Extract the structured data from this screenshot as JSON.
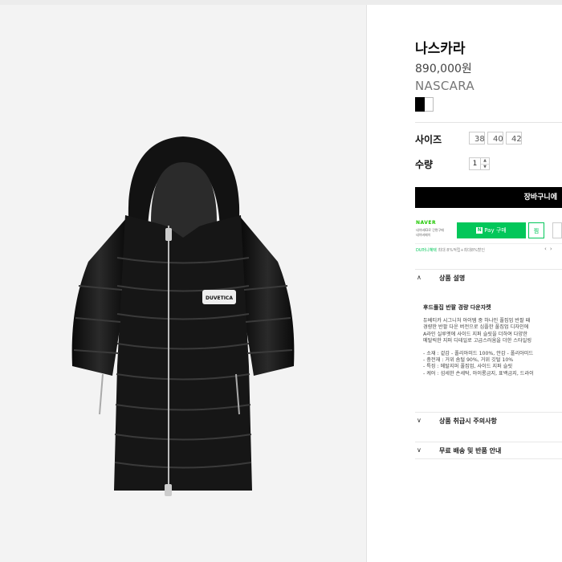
{
  "product": {
    "title": "나스카라",
    "price": "890,000원",
    "brand": "NASCARA",
    "jacket_logo": "DUVETICA",
    "colors": [
      "#000000",
      "#ffffff"
    ]
  },
  "options": {
    "size_label": "사이즈",
    "sizes": [
      "38",
      "40",
      "42"
    ],
    "qty_label": "수량",
    "qty_value": "1"
  },
  "cart": {
    "label": "장바구니에"
  },
  "npay": {
    "naver_logo": "NAVER",
    "sub1": "네이버ID로 간편구매",
    "sub2": "네이버페이",
    "pay_label": "Pay 구매",
    "zzim_label": "찜"
  },
  "benefit": {
    "prefix": "DU머니혜택",
    "text": " 최대 8%적립+최대8%할인"
  },
  "accordion": [
    {
      "label": "상품 설명",
      "icon": "chevron-up-icon"
    },
    {
      "label": "상품 취급시 주의사항",
      "icon": "chevron-down-icon"
    },
    {
      "label": "무료 배송 및 반품 안내",
      "icon": "chevron-down-icon"
    }
  ],
  "description": {
    "title": "후드풀집 반팔 경량 다운자켓",
    "intro": [
      "듀베티카 시그니처 아이템 중 하나인 풀집업 반팔 패",
      "경량한 반팔 다운 버전으로 심플한 풀집업 디자인에",
      "A라인 실루엣에 사이드 지퍼 슬릿을 더하여 다양한",
      "메탈릭한 지퍼 디테일로 고급스러움을 더한 스타일링"
    ],
    "specs": [
      "- 소재 : 겉감 - 폴리아미드 100%, 안감 - 폴리아미드",
      "- 충전재 : 거위 솜털 90%, 거위 깃털 10%",
      "- 특징 : 메탈지퍼 풀집업, 사이드 지퍼 슬릿",
      "- 케어 : 섬세한 손세탁, 아이롱금지, 표백금지, 드라이"
    ]
  }
}
